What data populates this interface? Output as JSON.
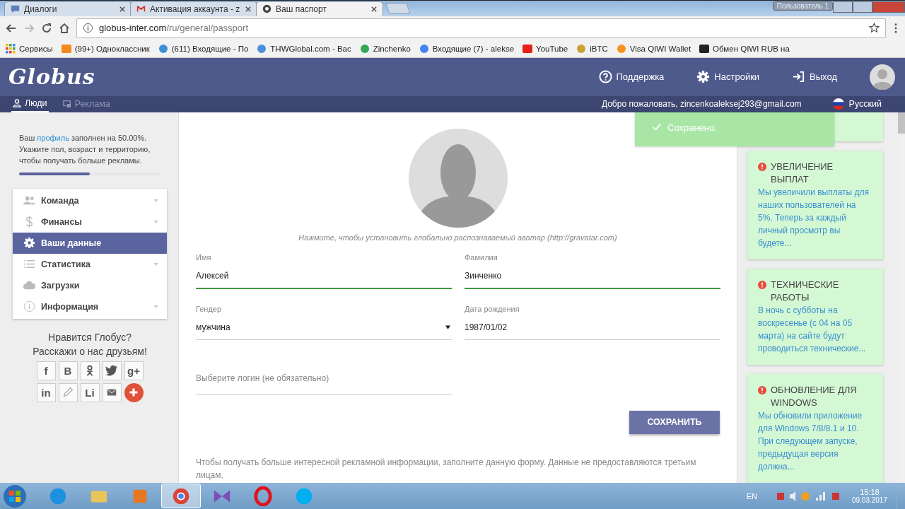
{
  "browser": {
    "tabs": [
      {
        "title": "Диалоги",
        "selected": false
      },
      {
        "title": "Активация аккаунта - z",
        "selected": false
      },
      {
        "title": "Ваш паспорт",
        "selected": true
      }
    ],
    "user": "Пользователь 1",
    "address_host": "globus-inter.com",
    "address_path": "/ru/general/passport",
    "bookmarks": [
      "Сервисы",
      "(99+) Одноклассник",
      "(611) Входящие - По",
      "THWGlobal.com - Вас",
      "Zinchenko",
      "Входящие (7) - alekse",
      "YouTube",
      "iBTC",
      "Visa QIWI Wallet",
      "Обмен QIWI RUB на"
    ]
  },
  "header": {
    "logo": "Globus",
    "nav": [
      "Поддержка",
      "Настройки",
      "Выход"
    ],
    "subnav": [
      {
        "label": "Люди",
        "selected": true
      },
      {
        "label": "Реклама",
        "selected": false
      }
    ],
    "welcome": "Добро пожаловать, zincenkoaleksej293@gmail.com",
    "language": "Русский"
  },
  "sidebar": {
    "note_before": "Ваш ",
    "profile_link": "профиль",
    "note_after": " заполнен на 50.00%. Укажите пол, возраст и территорию, чтобы получать больше рекламы.",
    "progress": {
      "level": 0.5
    },
    "menu": [
      {
        "label": "Команда",
        "selected": false,
        "caret": true
      },
      {
        "label": "Финансы",
        "selected": false,
        "caret": true
      },
      {
        "label": "Ваши данные",
        "selected": true,
        "caret": false
      },
      {
        "label": "Статистика",
        "selected": false,
        "caret": true
      },
      {
        "label": "Загрузки",
        "selected": false,
        "caret": false
      },
      {
        "label": "Информация",
        "selected": false,
        "caret": true
      }
    ],
    "share_title": [
      "Нравится Глобус?",
      "Расскажи о нас друзьям!"
    ],
    "social": [
      {
        "kind": "text",
        "label": "f"
      },
      {
        "kind": "text",
        "label": "B"
      },
      {
        "kind": "ok"
      },
      {
        "kind": "twitter"
      },
      {
        "kind": "text",
        "label": "g+"
      },
      {
        "kind": "text",
        "label": "in"
      },
      {
        "kind": "pencil"
      },
      {
        "kind": "text",
        "label": "Li"
      },
      {
        "kind": "mail"
      },
      {
        "kind": "plus"
      }
    ]
  },
  "form": {
    "avatar_hint": "Нажмите, чтобы установить глобально распознаваемый аватар (http://gravatar.com)",
    "fields": [
      {
        "label": "Имя",
        "value": "Алексей",
        "kind": "text",
        "valid": true
      },
      {
        "label": "Фамилия",
        "value": "Зинченко",
        "kind": "text",
        "valid": true
      },
      {
        "label": "Гендер",
        "value": "мужчина",
        "kind": "select",
        "valid": false
      },
      {
        "label": "Дата рождения",
        "value": "1987/01/02",
        "kind": "text",
        "valid": false
      }
    ],
    "login_placeholder": "Выберите логин (не обязательно)",
    "save_button": "СОХРАНИТЬ",
    "note": "Чтобы получать больше интересной рекламной информации, заполните данную форму. Данные не предоставляются третьим лицам."
  },
  "toast": "Сохранено.",
  "news": [
    {
      "title": "УВЕЛИЧЕНИЕ ВЫПЛАТ",
      "body": "Мы увеличили выплаты для наших пользователей на 5%. Теперь за каждый личный просмотр вы будете..."
    },
    {
      "title": "ТЕХНИЧЕСКИЕ РАБОТЫ",
      "body": "В ночь с субботы на воскресенье (с 04 на 05 марта) на сайте будут проводиться технические..."
    },
    {
      "title": "ОБНОВЛЕНИЕ ДЛЯ WINDOWS",
      "body": "Мы обновили приложение для Windows 7/8/8.1 и 10. При следующем запуске, предыдущая версия должна..."
    }
  ],
  "taskbar": {
    "apps": [
      {
        "kind": "ie",
        "active": false
      },
      {
        "kind": "folder",
        "active": false
      },
      {
        "kind": "media",
        "active": false
      },
      {
        "kind": "chrome",
        "active": true
      },
      {
        "kind": "vs",
        "active": false
      },
      {
        "kind": "opera",
        "active": false
      },
      {
        "kind": "skype",
        "active": false
      }
    ],
    "language": "EN",
    "time": "15:18",
    "date": "09.03.2017"
  }
}
